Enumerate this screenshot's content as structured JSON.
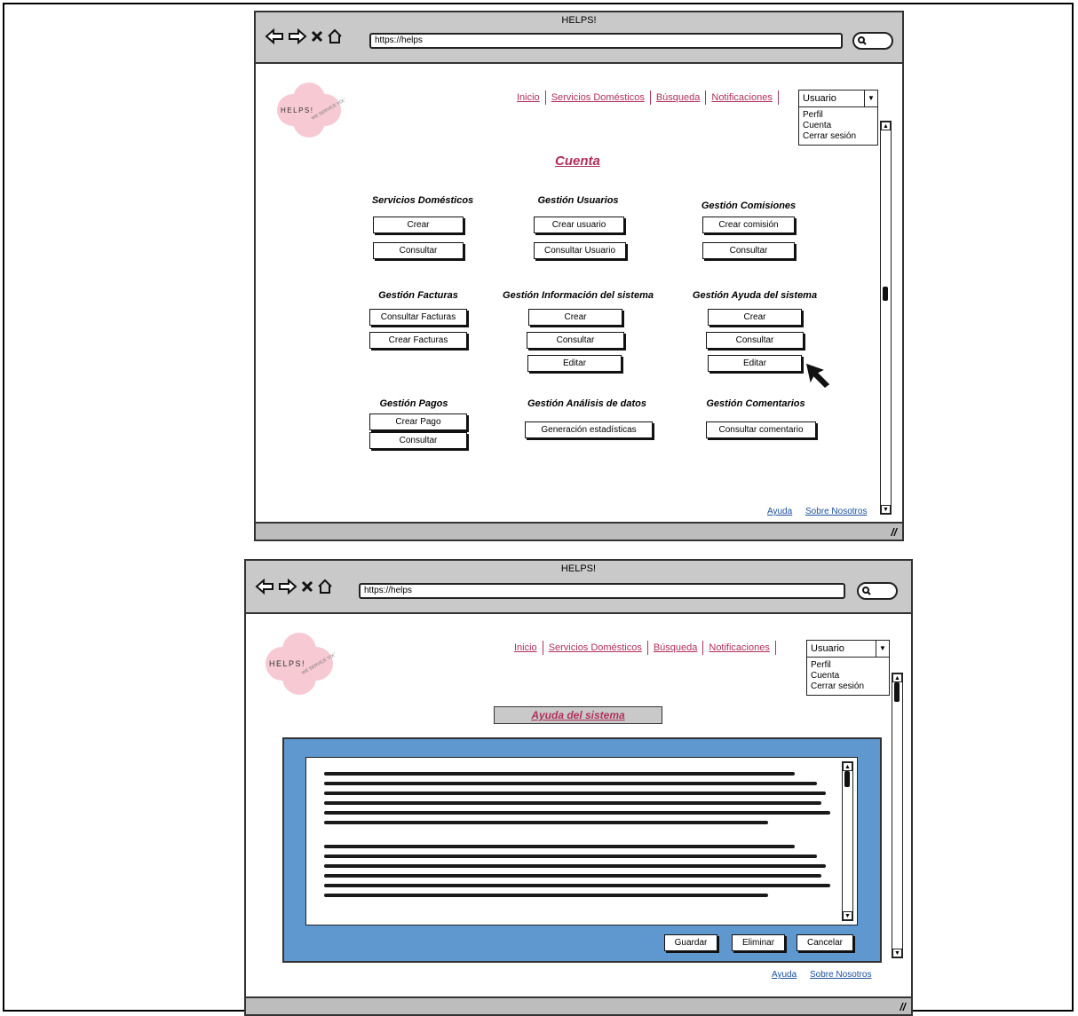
{
  "browser": {
    "title": "HELPS!",
    "url": "https://helps"
  },
  "logo": {
    "text": "HELPS!",
    "subtext": "WE SERVICE YOU"
  },
  "nav": {
    "inicio": "Inicio",
    "servicios": "Servicios Domésticos",
    "busqueda": "Búsqueda",
    "notificaciones": "Notificaciones"
  },
  "user_menu": {
    "selected": "Usuario",
    "items": [
      "Perfil",
      "Cuenta",
      "Cerrar sesión"
    ]
  },
  "cuenta": {
    "title": "Cuenta",
    "groups": {
      "servicios": {
        "title": "Servicios Domésticos",
        "buttons": [
          "Crear",
          "Consultar"
        ]
      },
      "usuarios": {
        "title": "Gestión Usuarios",
        "buttons": [
          "Crear usuario",
          "Consultar Usuario"
        ]
      },
      "comisiones": {
        "title": "Gestión Comisiones",
        "buttons": [
          "Crear comisión",
          "Consultar"
        ]
      },
      "facturas": {
        "title": "Gestión Facturas",
        "buttons": [
          "Consultar Facturas",
          "Crear Facturas"
        ]
      },
      "informacion": {
        "title": "Gestión Información del sistema",
        "buttons": [
          "Crear",
          "Consultar",
          "Editar"
        ]
      },
      "ayuda": {
        "title": "Gestión Ayuda del sistema",
        "buttons": [
          "Crear",
          "Consultar",
          "Editar"
        ]
      },
      "pagos": {
        "title": "Gestión Pagos",
        "buttons": [
          "Crear Pago",
          "Consultar"
        ]
      },
      "analisis": {
        "title": "Gestión Análisis de datos",
        "buttons": [
          "Generación estadísticas"
        ]
      },
      "comentarios": {
        "title": "Gestión Comentarios",
        "buttons": [
          "Consultar comentario"
        ]
      }
    }
  },
  "footer": {
    "ayuda": "Ayuda",
    "sobre": "Sobre Nosotros"
  },
  "ayuda_page": {
    "title": "Ayuda del sistema",
    "buttons": {
      "guardar": "Guardar",
      "eliminar": "Eliminar",
      "cancelar": "Cancelar"
    }
  },
  "colors": {
    "link": "#b0305a",
    "footer_link": "#1b4f9c",
    "panel": "#5f97cf",
    "chrome": "#c9c9c9",
    "logo": "#f6c9d3"
  }
}
